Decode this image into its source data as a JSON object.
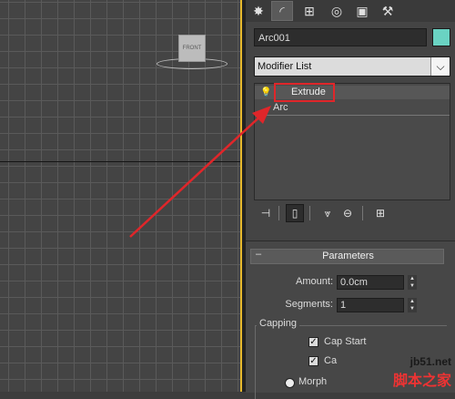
{
  "viewport": {
    "viewcube_label": "FRONT"
  },
  "command_panel": {
    "tabs": [
      {
        "name": "create-tab-icon",
        "glyph": "✸"
      },
      {
        "name": "modify-tab-icon",
        "glyph": "◜"
      },
      {
        "name": "hierarchy-tab-icon",
        "glyph": "⊞"
      },
      {
        "name": "motion-tab-icon",
        "glyph": "◎"
      },
      {
        "name": "display-tab-icon",
        "glyph": "▣"
      },
      {
        "name": "utilities-tab-icon",
        "glyph": "⚒"
      }
    ],
    "object_name": "Arc001",
    "object_color": "#6ad3c3",
    "modifier_list": {
      "label": "Modifier List",
      "arrow": "⌵"
    },
    "stack": [
      {
        "name": "Extrude",
        "icon": "bulb-icon"
      },
      {
        "name": "Arc"
      }
    ],
    "stack_toolbar": {
      "pin": "⊣",
      "show_end": "▯",
      "unique": "⩔",
      "remove": "⊖",
      "configure": "⊞"
    }
  },
  "parameters": {
    "title": "Parameters",
    "collapse": "–",
    "amount_label": "Amount:",
    "amount_value": "0.0cm",
    "segments_label": "Segments:",
    "segments_value": "1",
    "capping": {
      "label": "Capping",
      "cap_start": "Cap Start",
      "cap_end": "Ca",
      "morph": "Morph"
    },
    "check_glyph": "✓",
    "spinner_up": "▲",
    "spinner_down": "▼"
  },
  "annotation": {
    "highlight_color": "#e0262a"
  },
  "watermark": {
    "url": "jb51.net",
    "sub": "脚本之家"
  }
}
